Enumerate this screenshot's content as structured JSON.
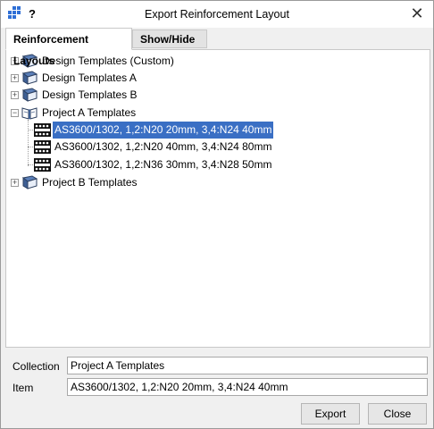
{
  "window": {
    "title": "Export Reinforcement Layout",
    "help_glyph": "?",
    "close_glyph": "✕"
  },
  "tabs": [
    {
      "label": "Reinforcement Layouts",
      "active": true
    },
    {
      "label": "Show/Hide",
      "active": false
    }
  ],
  "tree": {
    "nodes": [
      {
        "label": "Design Templates (Custom)",
        "expanded": false,
        "icon": "book-icon"
      },
      {
        "label": "Design Templates A",
        "expanded": false,
        "icon": "book-icon"
      },
      {
        "label": "Design Templates B",
        "expanded": false,
        "icon": "book-icon"
      },
      {
        "label": "Project A Templates",
        "expanded": true,
        "icon": "open-book-icon",
        "children": [
          {
            "label": "AS3600/1302, 1,2:N20 20mm, 3,4:N24 40mm",
            "selected": true,
            "icon": "rebar-layout-icon"
          },
          {
            "label": "AS3600/1302, 1,2:N20 40mm, 3,4:N24 80mm",
            "selected": false,
            "icon": "rebar-layout-icon"
          },
          {
            "label": "AS3600/1302, 1,2:N36 30mm, 3,4:N28 50mm",
            "selected": false,
            "icon": "rebar-layout-icon"
          }
        ]
      },
      {
        "label": "Project B Templates",
        "expanded": false,
        "icon": "book-icon"
      }
    ]
  },
  "form": {
    "collection_label": "Collection",
    "collection_value": "Project A Templates",
    "item_label": "Item",
    "item_value": "AS3600/1302, 1,2:N20 20mm, 3,4:N24 40mm"
  },
  "buttons": {
    "export_label": "Export",
    "close_label": "Close"
  },
  "colors": {
    "selection": "#3a6fc4",
    "app_icon": "#2f6fd6"
  }
}
